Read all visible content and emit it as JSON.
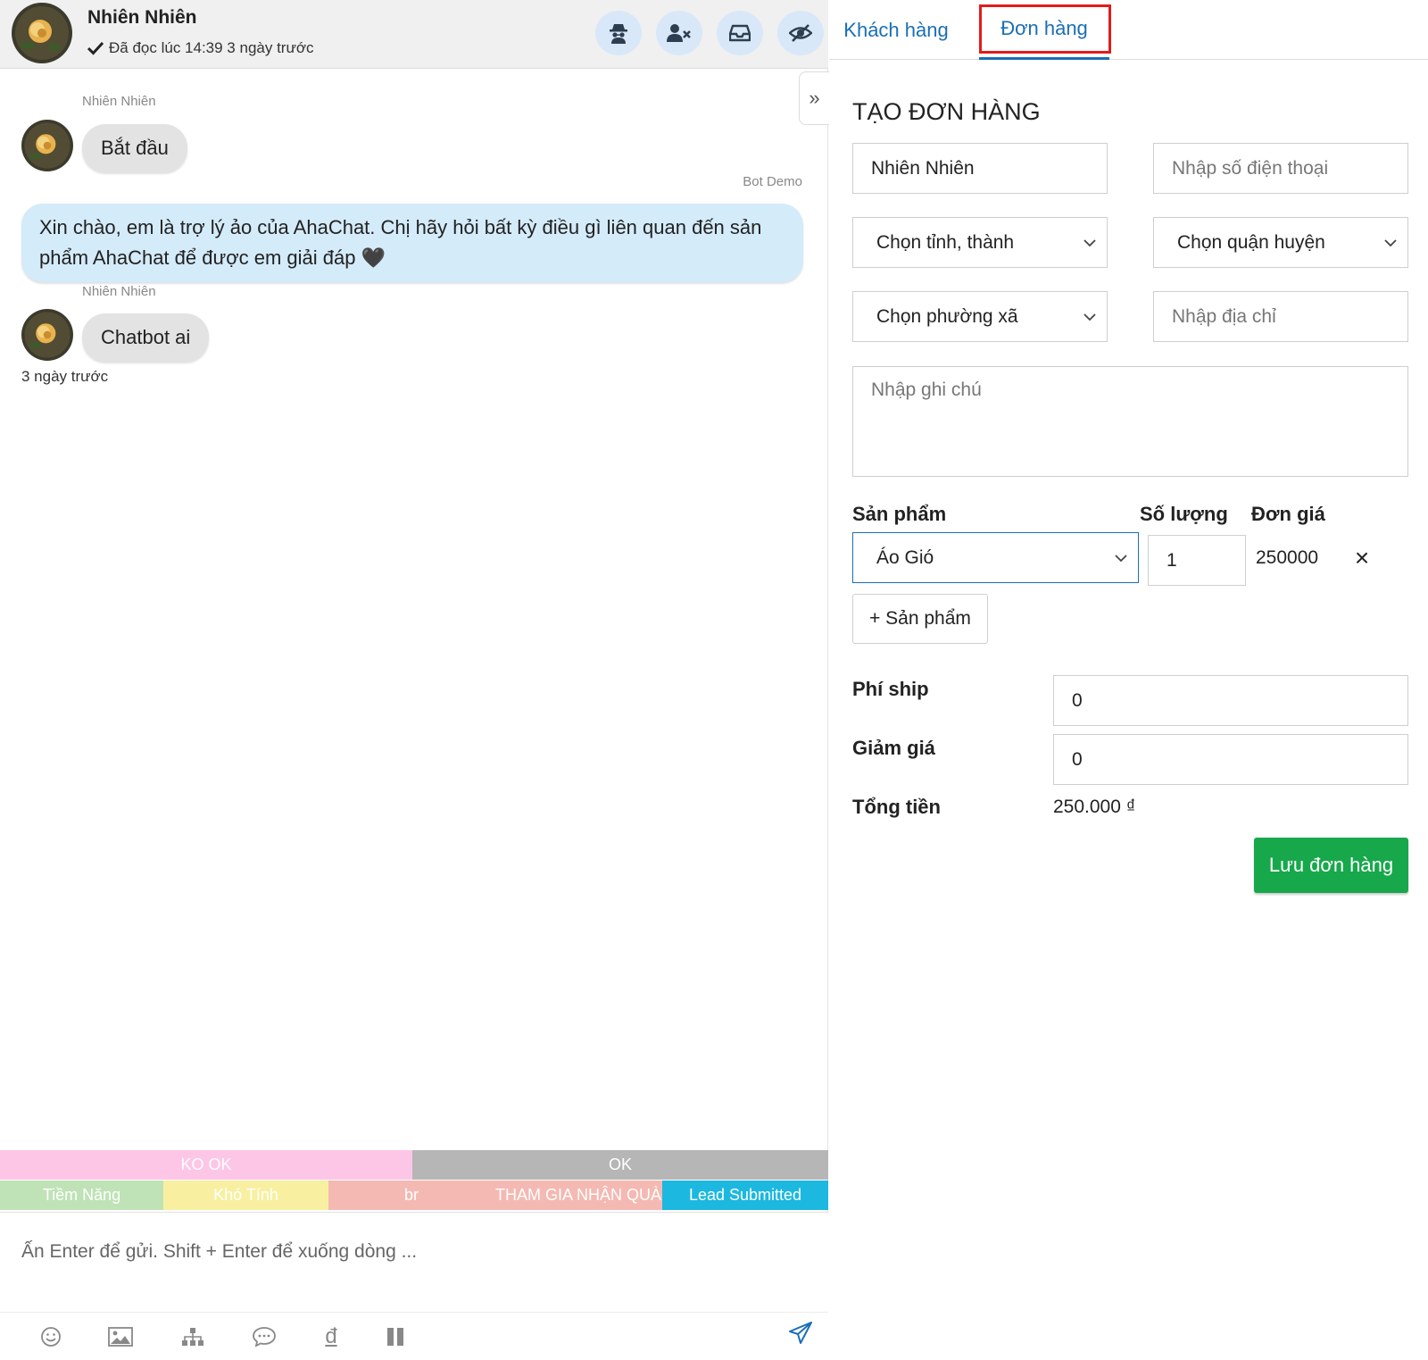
{
  "chat": {
    "contact_name": "Nhiên Nhiên",
    "read_status": "Đã đọc lúc 14:39 3 ngày trước",
    "header_icons": [
      "spy-icon",
      "user-remove-icon",
      "inbox-icon",
      "eye-slash-icon"
    ],
    "collapse_glyph": "»",
    "messages": [
      {
        "sender": "Nhiên Nhiên",
        "text": "Bắt đầu",
        "from": "user"
      },
      {
        "sender": "Bot Demo",
        "text": "Xin chào, em là trợ lý ảo của AhaChat. Chị hãy hỏi bất kỳ điều gì liên quan đến sản phẩm AhaChat để được em giải đáp 🖤",
        "from": "bot"
      },
      {
        "sender": "Nhiên Nhiên",
        "text": "Chatbot ai",
        "from": "user"
      }
    ],
    "time_ago": "3 ngày trước",
    "tags_row1": [
      {
        "label": "KO OK",
        "color": "#fec6e6"
      },
      {
        "label": "OK",
        "color": "#b6b6b6"
      }
    ],
    "tags_row2": [
      {
        "label": "Tiềm Năng",
        "color": "#bfe3b6"
      },
      {
        "label": "Khó Tính",
        "color": "#f8f0a0"
      },
      {
        "label": "br",
        "color": "#f4b9b2"
      },
      {
        "label": "THAM GIA NHẬN QUÀ",
        "color": "#f4b9b2"
      },
      {
        "label": "Lead Submitted",
        "color": "#1cb8e0"
      }
    ],
    "composer_placeholder": "Ấn Enter để gửi. Shift + Enter để xuống dòng ...",
    "toolbar_icons": [
      "emoji-icon",
      "image-icon",
      "flow-icon",
      "comment-icon",
      "currency-icon",
      "pause-icon",
      "send-icon"
    ],
    "currency_glyph": "đ"
  },
  "panel": {
    "tabs": [
      {
        "label": "Khách hàng",
        "active": false
      },
      {
        "label": "Đơn hàng",
        "active": true
      }
    ],
    "form_title": "TẠO ĐƠN HÀNG",
    "name_value": "Nhiên Nhiên",
    "phone_placeholder": "Nhập số điện thoại",
    "province_placeholder": "Chọn tỉnh, thành",
    "district_placeholder": "Chọn quận huyện",
    "ward_placeholder": "Chọn phường xã",
    "address_placeholder": "Nhập địa chỉ",
    "note_placeholder": "Nhập ghi chú",
    "product_header": "Sản phẩm",
    "qty_header": "Số lượng",
    "price_header": "Đơn giá",
    "product_value": "Áo Gió",
    "qty_value": "1",
    "price_value": "250000",
    "remove_glyph": "×",
    "add_product_label": "+ Sản phẩm",
    "ship_label": "Phí ship",
    "ship_value": "0",
    "discount_label": "Giảm giá",
    "discount_value": "0",
    "total_label": "Tổng tiền",
    "total_value": "250.000 ₫",
    "save_label": "Lưu đơn hàng",
    "accent_color": "#1a6fb5",
    "highlight_color": "#e21b1b",
    "save_color": "#18a84c"
  }
}
